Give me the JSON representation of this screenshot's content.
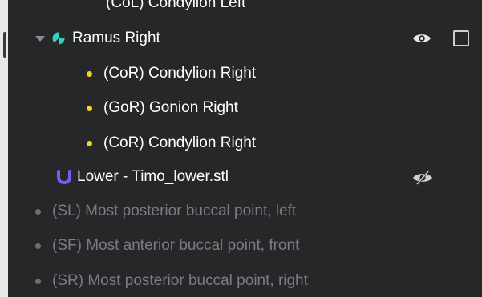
{
  "tree": {
    "top_partial": "(CoL) Condylion Left",
    "group": {
      "label": "Ramus Right",
      "icon": "ramus-segment-icon",
      "visibility_icon": "eye-icon",
      "children": [
        "(CoR) Condylion Right",
        "(GoR) Gonion Right",
        "(CoR) Condylion Right"
      ]
    },
    "model": {
      "label": "Lower - Timo_lower.stl",
      "icon": "lower-jaw-u-icon",
      "visibility_icon": "eye-off-icon"
    },
    "points": [
      "(SL) Most posterior buccal point, left",
      "(SF) Most anterior buccal point, front",
      "(SR) Most posterior buccal point, right"
    ]
  },
  "colors": {
    "panel_bg": "#262729",
    "text": "#ffffff",
    "muted_text": "#7c7c80",
    "point_dot": "#f5d21c",
    "ramus_icon": "#2fd3c0",
    "lower_icon": "#7a5cf0"
  }
}
